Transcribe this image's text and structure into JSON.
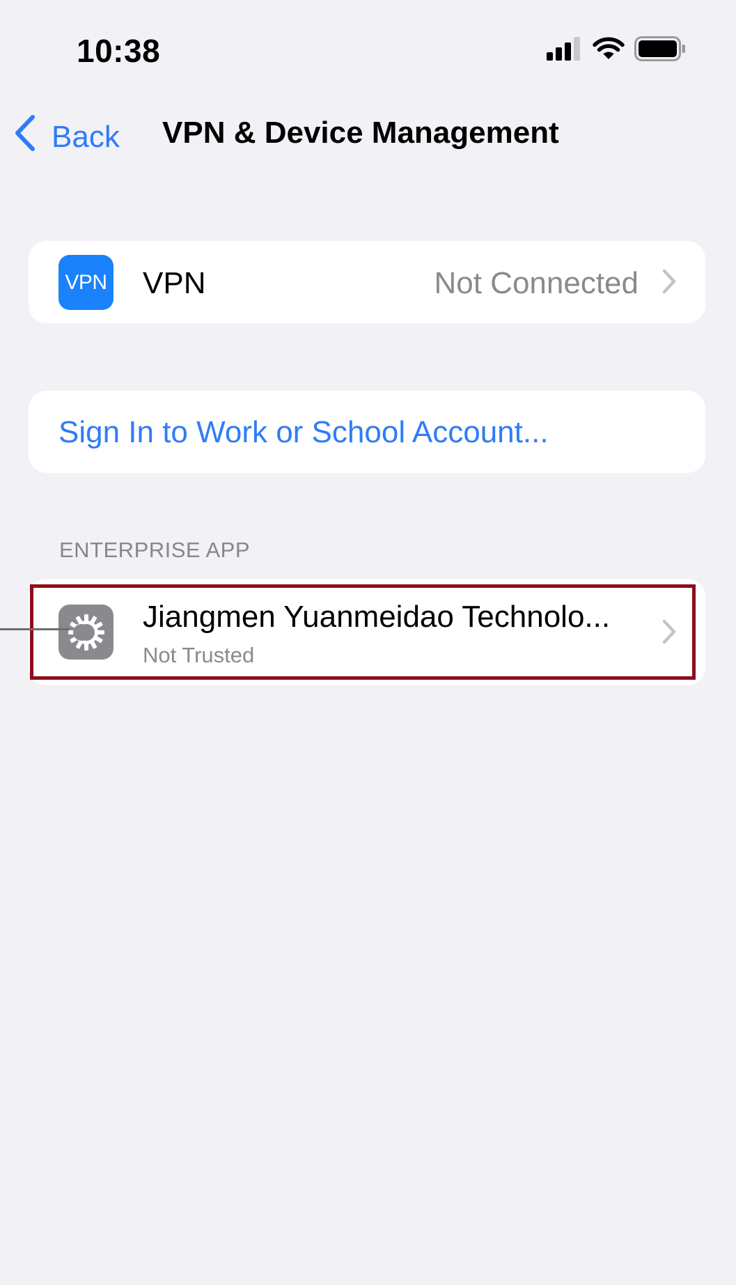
{
  "status_bar": {
    "time": "10:38",
    "icons": [
      "cellular-signal-icon",
      "wifi-icon",
      "battery-icon"
    ]
  },
  "nav": {
    "back_label": "Back",
    "title": "VPN & Device Management"
  },
  "vpn": {
    "icon_text": "VPN",
    "label": "VPN",
    "value": "Not Connected"
  },
  "signin": {
    "label": "Sign In to Work or School Account..."
  },
  "enterprise": {
    "section_header": "ENTERPRISE APP",
    "items": [
      {
        "name": "Jiangmen Yuanmeidao Technolo...",
        "status": "Not Trusted"
      }
    ]
  },
  "colors": {
    "accent_blue": "#2f7cf6",
    "vpn_icon_blue": "#1a82fb",
    "highlight_red": "#8c0e1a",
    "background": "#f2f1f6",
    "secondary_text": "#8a8a8e"
  }
}
